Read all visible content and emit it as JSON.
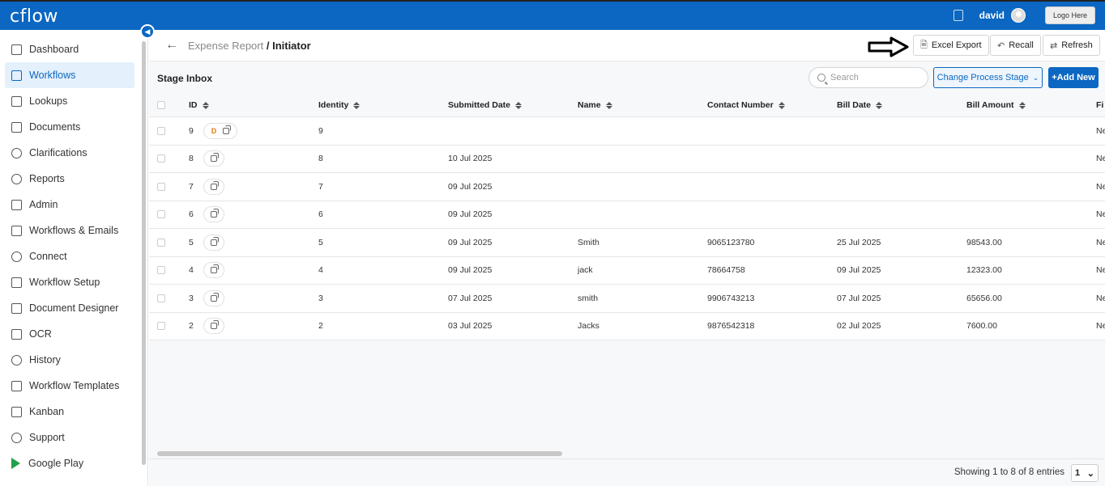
{
  "app": {
    "logo": "cflow",
    "username": "david",
    "logo_placeholder": "Logo Here"
  },
  "sidebar": {
    "items": [
      {
        "label": "Dashboard",
        "icon": "dashboard-icon"
      },
      {
        "label": "Workflows",
        "icon": "workflows-icon",
        "active": true
      },
      {
        "label": "Lookups",
        "icon": "table-icon"
      },
      {
        "label": "Documents",
        "icon": "document-icon"
      },
      {
        "label": "Clarifications",
        "icon": "bulb-icon"
      },
      {
        "label": "Reports",
        "icon": "pie-chart-icon"
      },
      {
        "label": "Admin",
        "icon": "admin-icon"
      },
      {
        "label": "Workflows & Emails",
        "icon": "mail-icon"
      },
      {
        "label": "Connect",
        "icon": "connect-icon"
      },
      {
        "label": "Workflow Setup",
        "icon": "sliders-icon"
      },
      {
        "label": "Document Designer",
        "icon": "edit-icon"
      },
      {
        "label": "OCR",
        "icon": "scan-icon"
      },
      {
        "label": "History",
        "icon": "history-icon"
      },
      {
        "label": "Workflow Templates",
        "icon": "template-icon"
      },
      {
        "label": "Kanban",
        "icon": "kanban-icon"
      },
      {
        "label": "Support",
        "icon": "headset-icon"
      },
      {
        "label": "Google Play",
        "icon": "google-play-icon"
      }
    ]
  },
  "header": {
    "breadcrumb_parent": "Expense Report",
    "breadcrumb_sep": " / ",
    "breadcrumb_current": "Initiator",
    "excel_export": "Excel Export",
    "recall": "Recall",
    "refresh": "Refresh"
  },
  "toolbar": {
    "title": "Stage Inbox",
    "search_placeholder": "Search",
    "change_stage": "Change Process Stage",
    "add_new": "+Add New"
  },
  "table": {
    "columns": [
      "ID",
      "Identity",
      "Submitted Date",
      "Name",
      "Contact Number",
      "Bill Date",
      "Bill Amount",
      "Fi"
    ],
    "rows": [
      {
        "id": "9",
        "badge": "D",
        "identity": "9",
        "submitted": "",
        "name": "",
        "contact": "",
        "bill_date": "",
        "bill_amount": "",
        "fi": "Ne"
      },
      {
        "id": "8",
        "badge": "",
        "identity": "8",
        "submitted": "10 Jul 2025",
        "name": "",
        "contact": "",
        "bill_date": "",
        "bill_amount": "",
        "fi": "Ne"
      },
      {
        "id": "7",
        "badge": "",
        "identity": "7",
        "submitted": "09 Jul 2025",
        "name": "",
        "contact": "",
        "bill_date": "",
        "bill_amount": "",
        "fi": "Ne"
      },
      {
        "id": "6",
        "badge": "",
        "identity": "6",
        "submitted": "09 Jul 2025",
        "name": "",
        "contact": "",
        "bill_date": "",
        "bill_amount": "",
        "fi": "Ne"
      },
      {
        "id": "5",
        "badge": "",
        "identity": "5",
        "submitted": "09 Jul 2025",
        "name": "Smith",
        "contact": "9065123780",
        "bill_date": "25 Jul 2025",
        "bill_amount": "98543.00",
        "fi": "Ne"
      },
      {
        "id": "4",
        "badge": "",
        "identity": "4",
        "submitted": "09 Jul 2025",
        "name": "jack",
        "contact": "78664758",
        "bill_date": "09 Jul 2025",
        "bill_amount": "12323.00",
        "fi": "Ne"
      },
      {
        "id": "3",
        "badge": "",
        "identity": "3",
        "submitted": "07 Jul 2025",
        "name": "smith",
        "contact": "9906743213",
        "bill_date": "07 Jul 2025",
        "bill_amount": "65656.00",
        "fi": "Ne"
      },
      {
        "id": "2",
        "badge": "",
        "identity": "2",
        "submitted": "03 Jul 2025",
        "name": "Jacks",
        "contact": "9876542318",
        "bill_date": "02 Jul 2025",
        "bill_amount": "7600.00",
        "fi": "Ne"
      }
    ]
  },
  "footer": {
    "entries_text": "Showing 1 to 8 of 8 entries",
    "page": "1"
  }
}
